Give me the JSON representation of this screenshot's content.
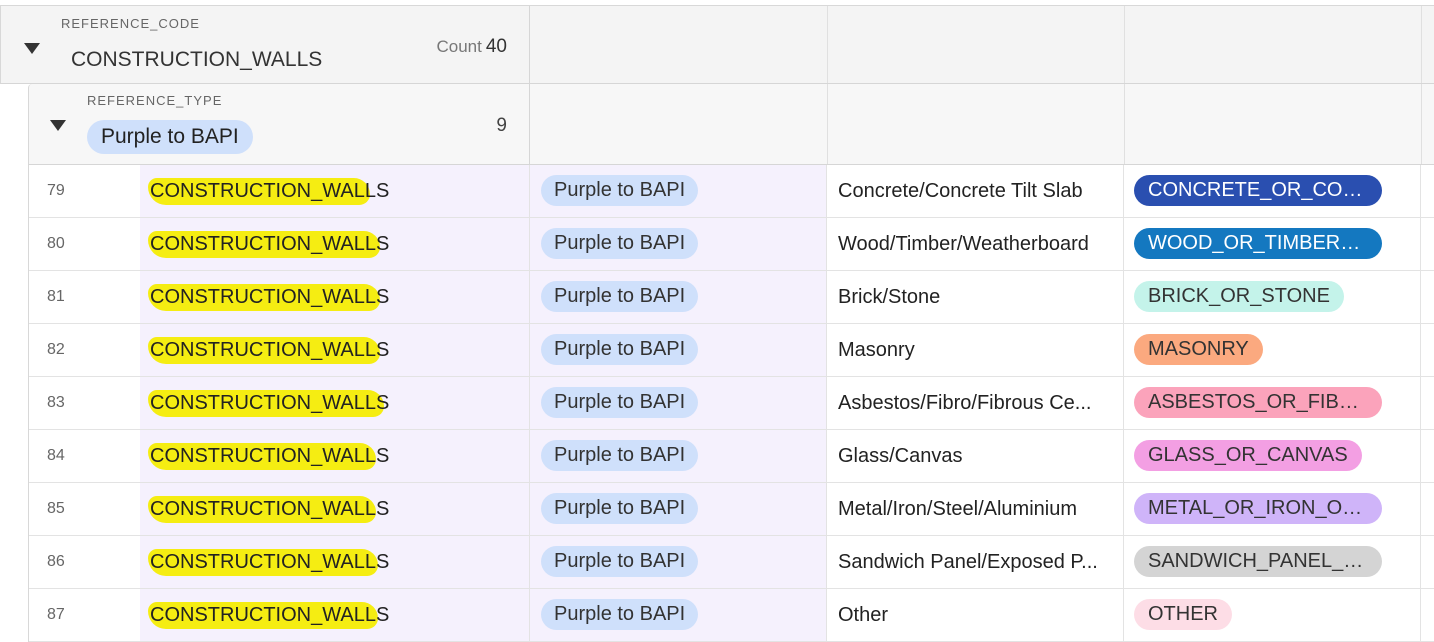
{
  "outer_group": {
    "caption": "REFERENCE_CODE",
    "title": "CONSTRUCTION_WALLS",
    "count_label": "Count",
    "count": "40"
  },
  "inner_group": {
    "caption": "REFERENCE_TYPE",
    "title": "Purple to BAPI",
    "count": "9"
  },
  "rows": [
    {
      "num": "79",
      "code": "CONSTRUCTION_WALLS",
      "type": "Purple to BAPI",
      "label": "Concrete/Concrete Tilt Slab",
      "enum": "CONCRETE_OR_CONCRETE_TILT_SLAB",
      "enum_bg": "#2a4fb0",
      "enum_fg": "#ffffff"
    },
    {
      "num": "80",
      "code": "CONSTRUCTION_WALLS",
      "type": "Purple to BAPI",
      "label": "Wood/Timber/Weatherboard",
      "enum": "WOOD_OR_TIMBER_OR_WEATHERBOARD",
      "enum_bg": "#1478c0",
      "enum_fg": "#ffffff"
    },
    {
      "num": "81",
      "code": "CONSTRUCTION_WALLS",
      "type": "Purple to BAPI",
      "label": "Brick/Stone",
      "enum": "BRICK_OR_STONE",
      "enum_bg": "#c4f3ea",
      "enum_fg": "#333333"
    },
    {
      "num": "82",
      "code": "CONSTRUCTION_WALLS",
      "type": "Purple to BAPI",
      "label": "Masonry",
      "enum": "MASONRY",
      "enum_bg": "#fba97f",
      "enum_fg": "#333333"
    },
    {
      "num": "83",
      "code": "CONSTRUCTION_WALLS",
      "type": "Purple to BAPI",
      "label": "Asbestos/Fibro/Fibrous Ce...",
      "enum": "ASBESTOS_OR_FIBRO_OR_FIBROUS_CEMENT",
      "enum_bg": "#fba3bb",
      "enum_fg": "#333333"
    },
    {
      "num": "84",
      "code": "CONSTRUCTION_WALLS",
      "type": "Purple to BAPI",
      "label": "Glass/Canvas",
      "enum": "GLASS_OR_CANVAS",
      "enum_bg": "#f39fe3",
      "enum_fg": "#333333"
    },
    {
      "num": "85",
      "code": "CONSTRUCTION_WALLS",
      "type": "Purple to BAPI",
      "label": "Metal/Iron/Steel/Aluminium",
      "enum": "METAL_OR_IRON_OR_STEEL_OR_ALUMINIUM",
      "enum_bg": "#cfb4f9",
      "enum_fg": "#333333"
    },
    {
      "num": "86",
      "code": "CONSTRUCTION_WALLS",
      "type": "Purple to BAPI",
      "label": "Sandwich Panel/Exposed P...",
      "enum": "SANDWICH_PANEL_OR_EXPOSED_PANEL",
      "enum_bg": "#d4d4d4",
      "enum_fg": "#333333"
    },
    {
      "num": "87",
      "code": "CONSTRUCTION_WALLS",
      "type": "Purple to BAPI",
      "label": "Other",
      "enum": "OTHER",
      "enum_bg": "#fddde6",
      "enum_fg": "#333333"
    }
  ]
}
